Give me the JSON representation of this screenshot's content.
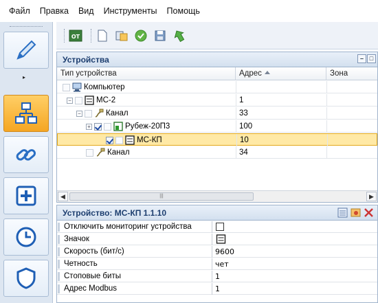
{
  "menu": {
    "items": [
      "Файл",
      "Правка",
      "Вид",
      "Инструменты",
      "Помощь"
    ]
  },
  "toolbar": {
    "buttons": [
      {
        "icon": "ot-icon",
        "label": "OT"
      },
      {
        "icon": "new-document-icon"
      },
      {
        "icon": "copy-config-icon"
      },
      {
        "icon": "apply-check-icon"
      },
      {
        "icon": "save-icon"
      },
      {
        "icon": "upload-arrow-icon"
      }
    ]
  },
  "nav": {
    "active_index": 1,
    "items": [
      "pencil-icon",
      "devices-network-icon",
      "links-chain-icon",
      "add-plus-icon",
      "clock-icon",
      "shield-icon"
    ]
  },
  "devices": {
    "title": "Устройства",
    "columns": {
      "type": "Тип устройства",
      "address": "Адрес",
      "zone": "Зона"
    },
    "rows": [
      {
        "label": "Компьютер",
        "address": "",
        "icon": "computer-icon",
        "depth": 0,
        "selected": false
      },
      {
        "label": "МС-2",
        "address": "1",
        "icon": "module-icon",
        "depth": 1,
        "selected": false
      },
      {
        "label": "Канал",
        "address": "33",
        "icon": "channel-plug-icon",
        "depth": 2,
        "selected": false
      },
      {
        "label": "Рубеж-20П3",
        "address": "100",
        "icon": "device-green-icon",
        "depth": 3,
        "selected": false
      },
      {
        "label": "МС-КП",
        "address": "10",
        "icon": "module-icon",
        "depth": 3,
        "selected": true
      },
      {
        "label": "Канал",
        "address": "34",
        "icon": "channel-plug-icon",
        "depth": 2,
        "selected": false
      }
    ]
  },
  "properties": {
    "title": "Устройство: МС-КП 1.1.10",
    "rows": [
      {
        "name": "Отключить мониторинг устройства",
        "value": "",
        "kind": "checkbox"
      },
      {
        "name": "Значок",
        "value": "",
        "kind": "icon"
      },
      {
        "name": "Скорость (бит/с)",
        "value": "9600",
        "kind": "text"
      },
      {
        "name": "Четность",
        "value": "чет",
        "kind": "text"
      },
      {
        "name": "Стоповые биты",
        "value": "1",
        "kind": "text"
      },
      {
        "name": "Адрес Modbus",
        "value": "1",
        "kind": "text"
      }
    ]
  },
  "colors": {
    "selection": "#ffe9a6",
    "active_nav": "#f5a623",
    "header_text": "#1d3e6f"
  }
}
